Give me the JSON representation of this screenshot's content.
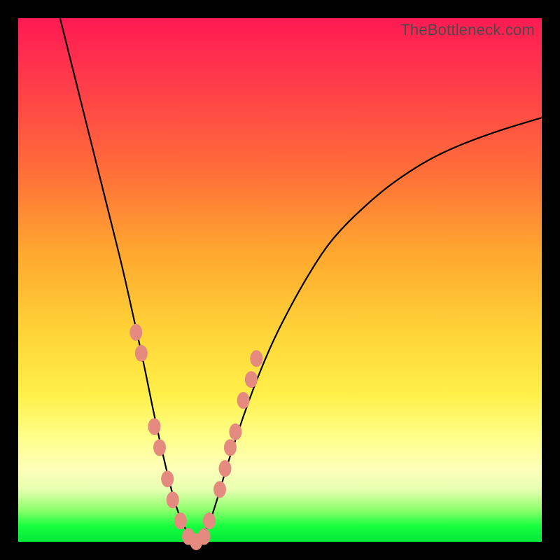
{
  "watermark": "TheBottleneck.com",
  "colors": {
    "frame": "#000000",
    "curve": "#000000",
    "marker": "#e58a7e",
    "gradient_top": "#ff1a52",
    "gradient_bottom": "#00e838"
  },
  "chart_data": {
    "type": "line",
    "title": "",
    "xlabel": "",
    "ylabel": "",
    "xlim": [
      0,
      100
    ],
    "ylim": [
      0,
      100
    ],
    "series": [
      {
        "name": "bottleneck-curve",
        "x": [
          8,
          10,
          12,
          14,
          16,
          18,
          20,
          22,
          24,
          26,
          28,
          30,
          32,
          34,
          36,
          38,
          40,
          44,
          48,
          52,
          56,
          60,
          66,
          72,
          80,
          90,
          100
        ],
        "y": [
          100,
          92,
          84,
          76,
          68,
          60,
          52,
          43,
          34,
          24,
          15,
          7,
          2,
          0,
          2,
          8,
          15,
          27,
          37,
          45,
          52,
          58,
          64,
          69,
          74,
          78,
          81
        ]
      }
    ],
    "markers": {
      "name": "highlighted-points",
      "x": [
        22.5,
        23.5,
        26.0,
        27.0,
        28.5,
        29.5,
        31.0,
        32.5,
        34.0,
        35.5,
        36.5,
        38.5,
        39.5,
        40.5,
        41.5,
        43.0,
        44.5,
        45.5
      ],
      "y": [
        40,
        36,
        22,
        18,
        12,
        8,
        4,
        1,
        0,
        1,
        4,
        10,
        14,
        18,
        21,
        27,
        31,
        35
      ]
    }
  }
}
